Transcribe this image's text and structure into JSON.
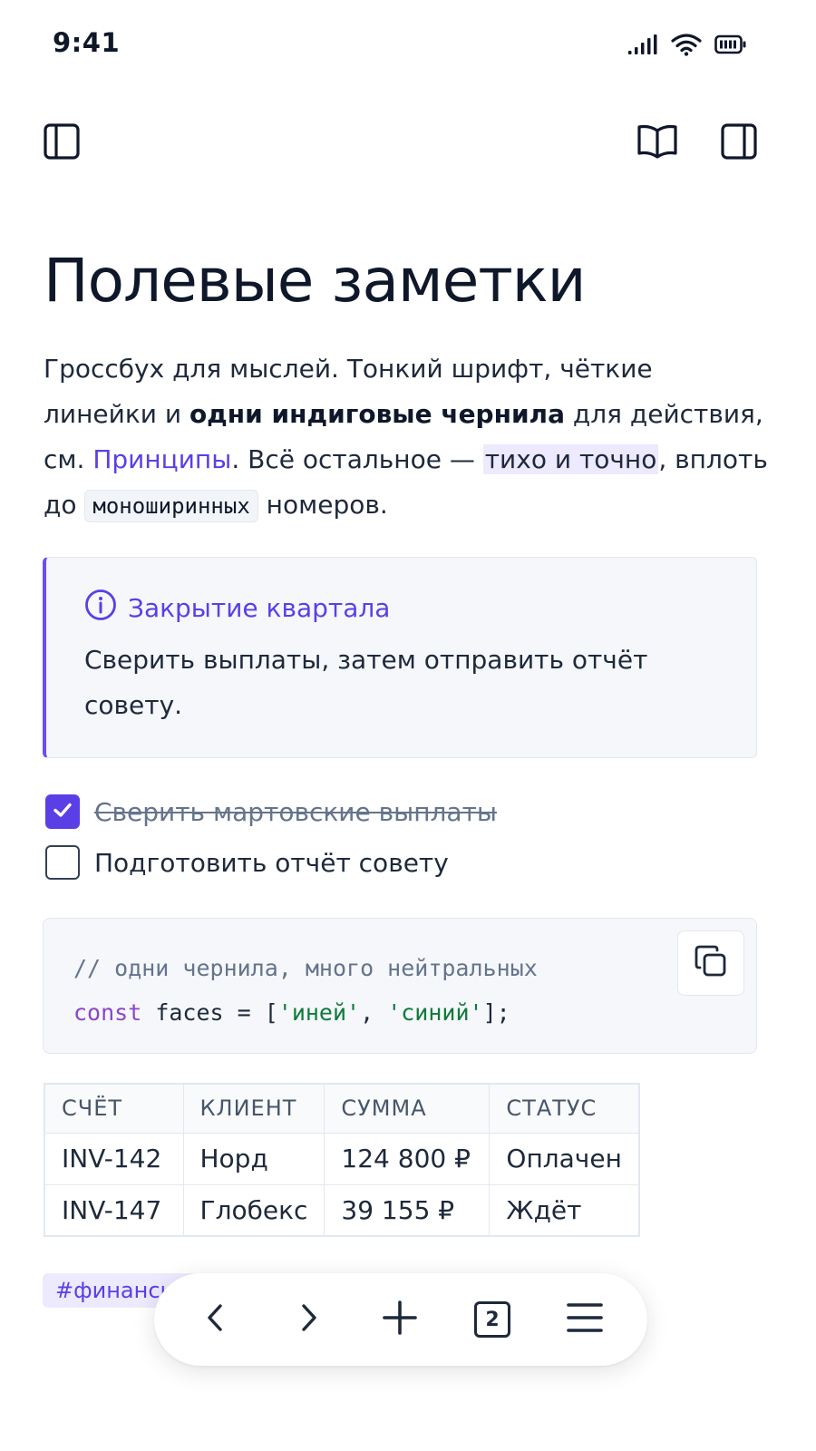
{
  "status_bar": {
    "time": "9:41",
    "icons": [
      "cellular-signal-icon",
      "wifi-icon",
      "battery-icon"
    ]
  },
  "toolbar": {
    "left_icon": "sidebar-left-icon",
    "reader_icon": "book-open-icon",
    "right_icon": "sidebar-right-icon"
  },
  "page": {
    "title": "Полевые заметки",
    "intro": {
      "part1": "Гроссбух для мыслей. Тонкий шрифт, чёткие линейки и ",
      "bold": "одни индиговые чернила",
      "part2": " для действия, см. ",
      "link": "Принципы",
      "part3": ". Всё остальное — ",
      "highlight": "тихо и точно",
      "part4": ", вплоть до ",
      "code": "моноширинных",
      "part5": " номеров."
    }
  },
  "callout": {
    "icon": "info-circle-icon",
    "title": "Закрытие квартала",
    "body": "Сверить выплаты, затем отправить отчёт совету."
  },
  "tasks": [
    {
      "label": "Сверить мартовские выплаты",
      "checked": true
    },
    {
      "label": "Подготовить отчёт совету",
      "checked": false
    }
  ],
  "code_block": {
    "comment": "// одни чернила, много нейтральных",
    "keyword": "const",
    "identifier": " faces = [",
    "string1": "'иней'",
    "separator": ", ",
    "string2": "'синий'",
    "closing": "];",
    "copy_icon": "copy-icon"
  },
  "table": {
    "headers": [
      "СЧЁТ",
      "КЛИЕНТ",
      "СУММА",
      "СТАТУС"
    ],
    "rows": [
      [
        "INV-142",
        "Норд",
        "124 800 ₽",
        "Оплачен"
      ],
      [
        "INV-147",
        "Глобекс",
        "39 155 ₽",
        "Ждёт"
      ]
    ]
  },
  "tag": "#финансы",
  "bottom_nav": {
    "back_icon": "chevron-left-icon",
    "forward_icon": "chevron-right-icon",
    "add_icon": "plus-icon",
    "tab_count": "2",
    "menu_icon": "hamburger-menu-icon"
  },
  "colors": {
    "accent": "#5b3fe6",
    "text": "#0f172a",
    "muted": "#64748b",
    "surface": "#f5f7fb",
    "border": "#e2e8f0",
    "code_string": "#0f7a3a",
    "code_keyword": "#8b46c8"
  }
}
